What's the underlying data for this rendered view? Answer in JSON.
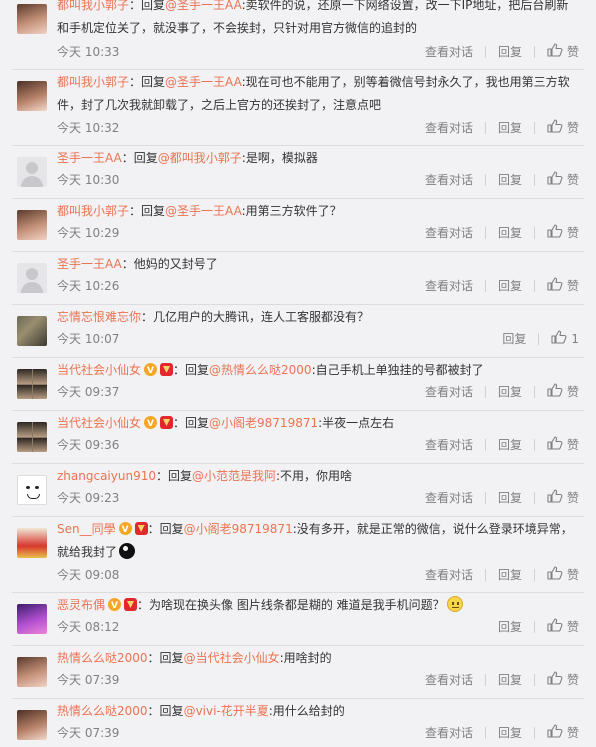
{
  "actions": {
    "dialog": "查看对话",
    "reply": "回复",
    "like": "赞"
  },
  "comments": [
    {
      "name": "都叫我小郭子",
      "pre": "：回复",
      "mention": "@圣手一王AA",
      "body": ":卖软件的说，还原一下网络设置，改一下IP地址，把后台刷新和手机定位关了，就没事了，不会挨封，只针对用官方微信的追封的",
      "time": "今天 10:33"
    },
    {
      "name": "都叫我小郭子",
      "pre": "：回复",
      "mention": "@圣手一王AA",
      "body": ":现在可也不能用了，别等着微信号封永久了，我也用第三方软件，封了几次我就卸载了，之后上官方的还挨封了，注意点吧",
      "time": "今天 10:32"
    },
    {
      "name": "圣手一王AA",
      "pre": "：回复",
      "mention": "@都叫我小郭子",
      "body": ":是啊，模拟器",
      "time": "今天 10:30"
    },
    {
      "name": "都叫我小郭子",
      "pre": "：回复",
      "mention": "@圣手一王AA",
      "body": ":用第三方软件了？",
      "time": "今天 10:29"
    },
    {
      "name": "圣手一王AA",
      "pre": "",
      "mention": "",
      "body": "：他妈的又封号了",
      "time": "今天 10:26"
    },
    {
      "name": "忘情忘恨难忘你",
      "pre": "",
      "mention": "",
      "body": "：几亿用户的大腾讯，连人工客服都没有？",
      "time": "今天 10:07",
      "likes": "1"
    },
    {
      "name": "当代社会小仙女",
      "pre": "：回复",
      "mention": "@热情么么哒2000",
      "body": ":自己手机上单独挂的号都被封了",
      "time": "今天 09:37"
    },
    {
      "name": "当代社会小仙女",
      "pre": "：回复",
      "mention": "@小阁老98719871",
      "body": ":半夜一点左右",
      "time": "今天 09:36"
    },
    {
      "name": "zhangcaiyun910",
      "pre": "：回复",
      "mention": "@小范范是我阿",
      "body": ":不用，你用啥",
      "time": "今天 09:23"
    },
    {
      "name": "Sen__同學",
      "pre": "：回复",
      "mention": "@小阁老98719871",
      "body": ":没有多开，就是正常的微信，说什么登录环境异常，就给我封了",
      "time": "今天 09:08"
    },
    {
      "name": "恶灵布偶",
      "pre": "",
      "mention": "",
      "body": "：为啥现在换头像 图片线条都是糊的 难道是我手机问题？",
      "time": "今天 08:12"
    },
    {
      "name": "热情么么哒2000",
      "pre": "：回复",
      "mention": "@当代社会小仙女",
      "body": ":用啥封的",
      "time": "今天 07:39"
    },
    {
      "name": "热情么么哒2000",
      "pre": "：回复",
      "mention": "@vivi-花开半夏",
      "body": ":用什么给封的",
      "time": "今天 07:39"
    }
  ]
}
